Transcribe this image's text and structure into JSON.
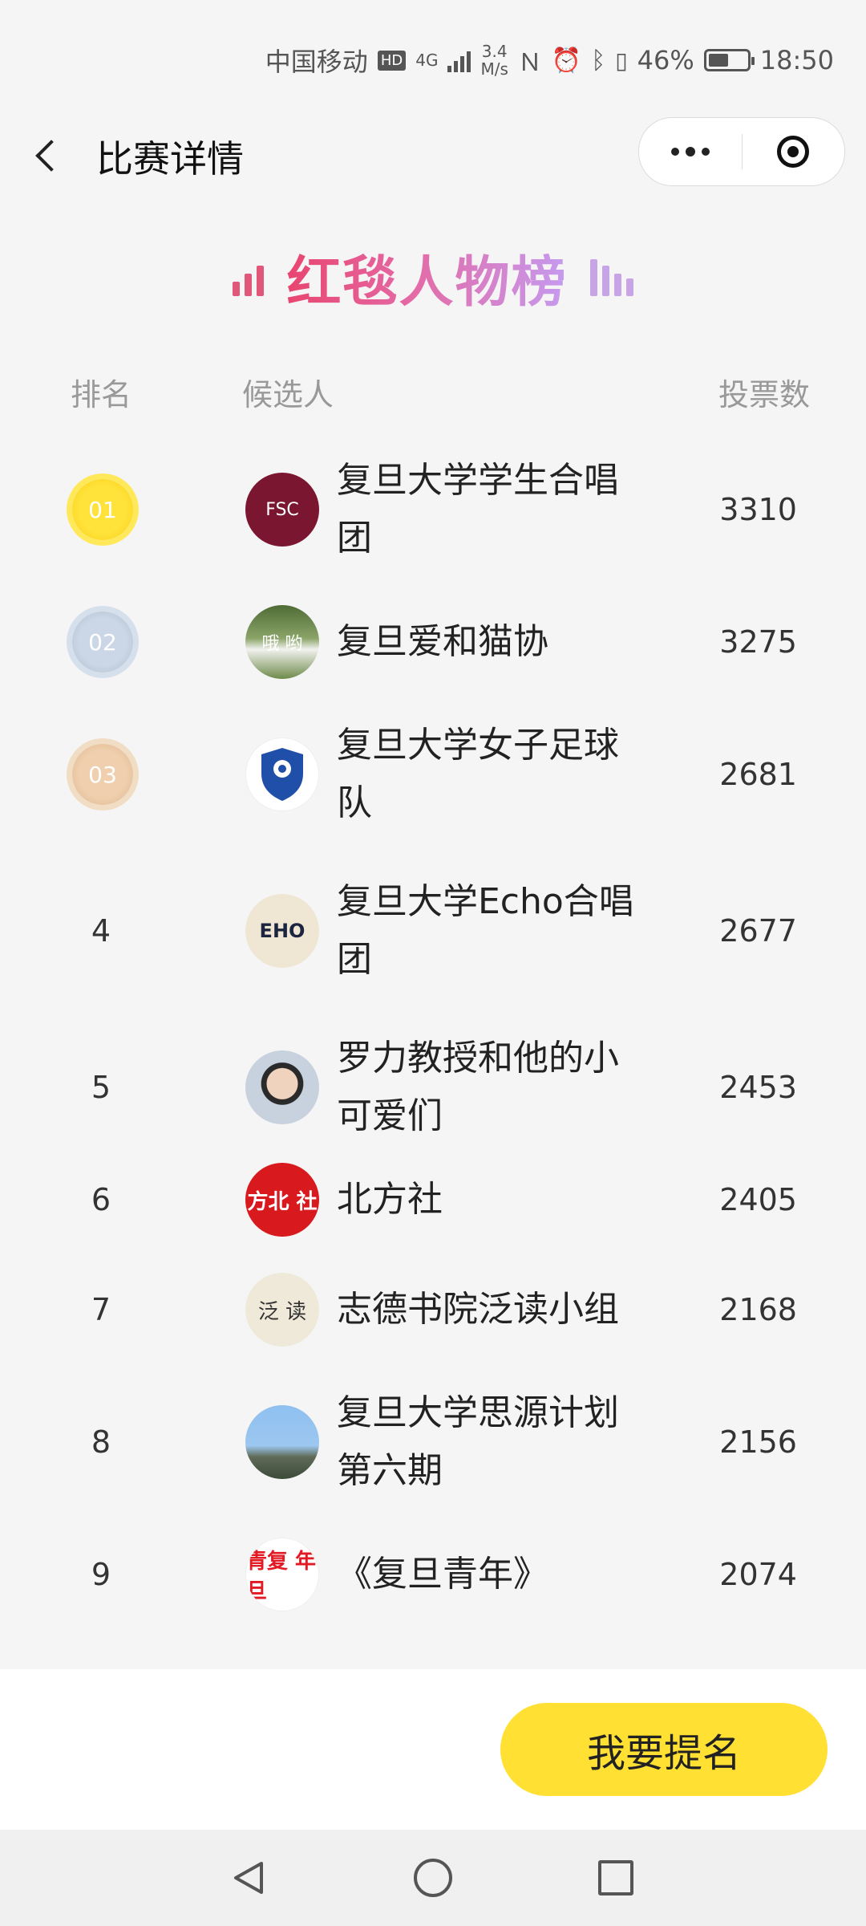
{
  "status_bar": {
    "carrier": "中国移动",
    "hd": "HD",
    "network": "4G",
    "speed_value": "3.4",
    "speed_unit": "M/s",
    "battery": "46%",
    "time": "18:50"
  },
  "nav": {
    "title": "比赛详情"
  },
  "banner": {
    "title": "红毯人物榜"
  },
  "table": {
    "headers": {
      "rank": "排名",
      "candidate": "候选人",
      "votes": "投票数"
    },
    "rows": [
      {
        "rank": "01",
        "name": "复旦大学学生合唱团",
        "votes": "3310",
        "avatar_color": "#7a1630",
        "avatar_text": "FSC"
      },
      {
        "rank": "02",
        "name": "复旦爱和猫协",
        "votes": "3275",
        "avatar_color": "#6f8a4f",
        "avatar_text": "哦 哟"
      },
      {
        "rank": "03",
        "name": "复旦大学女子足球队",
        "votes": "2681",
        "avatar_color": "#ffffff",
        "avatar_text": ""
      },
      {
        "rank": "4",
        "name": "复旦大学Echo合唱团",
        "votes": "2677",
        "avatar_color": "#efe7d3",
        "avatar_text": "EHO"
      },
      {
        "rank": "5",
        "name": "罗力教授和他的小可爱们",
        "votes": "2453",
        "avatar_color": "#8f9eb0",
        "avatar_text": ""
      },
      {
        "rank": "6",
        "name": "北方社",
        "votes": "2405",
        "avatar_color": "#d8191d",
        "avatar_text": "方北 社"
      },
      {
        "rank": "7",
        "name": "志德书院泛读小组",
        "votes": "2168",
        "avatar_color": "#efe9d9",
        "avatar_text": "泛 读"
      },
      {
        "rank": "8",
        "name": "复旦大学思源计划第六期",
        "votes": "2156",
        "avatar_color": "#86b6e8",
        "avatar_text": ""
      },
      {
        "rank": "9",
        "name": "《复旦青年》",
        "votes": "2074",
        "avatar_color": "#e11a24",
        "avatar_text": "青复 年旦"
      }
    ]
  },
  "bottom": {
    "nominate_label": "我要提名"
  }
}
